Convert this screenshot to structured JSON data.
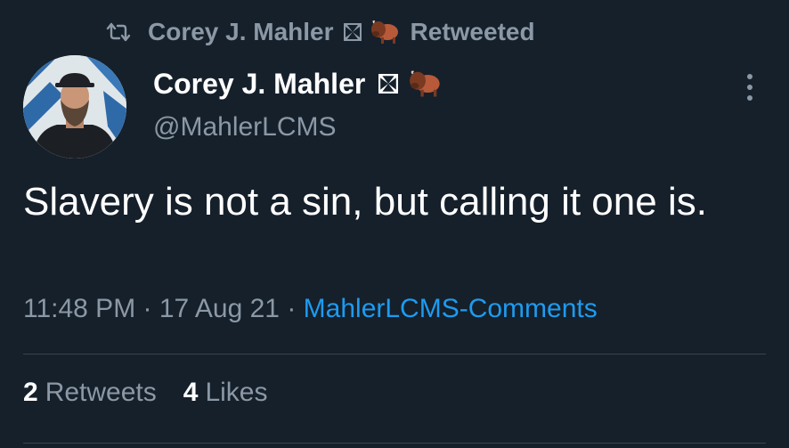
{
  "retweet_banner": {
    "icon": "retweet-icon",
    "name": "Corey J. Mahler",
    "badges": [
      "maltese-cross-icon",
      "bison-icon"
    ],
    "action": "Retweeted"
  },
  "author": {
    "display_name": "Corey J. Mahler",
    "handle": "@MahlerLCMS",
    "badges": [
      "maltese-cross-icon",
      "bison-icon"
    ],
    "avatar": "avatar-photo"
  },
  "more_menu": {
    "icon": "more-vertical-icon"
  },
  "tweet": {
    "text": "Slavery is not a sin, but calling it one is.",
    "time": "11:48 PM",
    "separator_1": " · ",
    "date": "17 Aug 21",
    "separator_2": " · ",
    "source": "MahlerLCMS-Comments"
  },
  "stats": {
    "retweets_count": "2",
    "retweets_label": "Retweets",
    "likes_count": "4",
    "likes_label": "Likes"
  },
  "colors": {
    "background": "#15202b",
    "primary_text": "#ffffff",
    "secondary_text": "#8b98a5",
    "link": "#1d9bf0",
    "divider": "#38444d"
  }
}
